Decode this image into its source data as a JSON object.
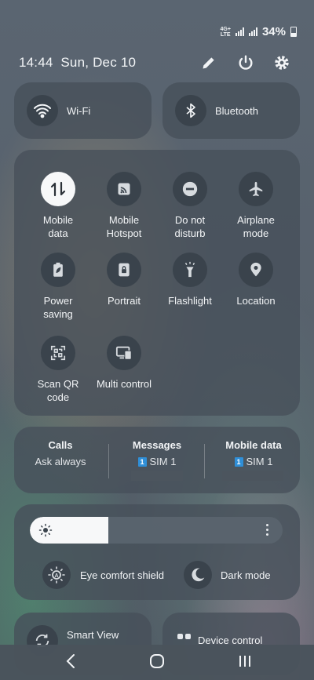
{
  "status_bar": {
    "network": "4G+",
    "network_sub": "LTE",
    "battery": "34%",
    "battery_level": 0.34
  },
  "header": {
    "datetime": "14:44  Sun, Dec 10"
  },
  "tiles": {
    "wifi": "Wi-Fi",
    "bluetooth": "Bluetooth"
  },
  "quick_settings": [
    {
      "label": "Mobile\ndata",
      "icon": "up-down-arrows-icon",
      "active": true
    },
    {
      "label": "Mobile\nHotspot",
      "icon": "hotspot-icon",
      "active": false
    },
    {
      "label": "Do not\ndisturb",
      "icon": "minus-circle-icon",
      "active": false
    },
    {
      "label": "Airplane\nmode",
      "icon": "airplane-icon",
      "active": false
    },
    {
      "label": "Power\nsaving",
      "icon": "battery-leaf-icon",
      "active": false
    },
    {
      "label": "Portrait",
      "icon": "lock-rotation-icon",
      "active": false
    },
    {
      "label": "Flashlight",
      "icon": "flashlight-icon",
      "active": false
    },
    {
      "label": "Location",
      "icon": "location-pin-icon",
      "active": false
    },
    {
      "label": "Scan QR\ncode",
      "icon": "qr-scan-icon",
      "active": false
    },
    {
      "label": "Multi control",
      "icon": "multi-control-icon",
      "active": false
    }
  ],
  "sim": {
    "calls": {
      "title": "Calls",
      "value": "Ask always"
    },
    "messages": {
      "title": "Messages",
      "badge": "1",
      "value": "SIM 1"
    },
    "mobile_data": {
      "title": "Mobile data",
      "badge": "1",
      "value": "SIM 1"
    }
  },
  "brightness": {
    "level": 0.31,
    "eye_comfort": "Eye comfort shield",
    "dark_mode": "Dark mode"
  },
  "bottom": {
    "smart_view": "Smart View",
    "device_control": "Device control"
  }
}
